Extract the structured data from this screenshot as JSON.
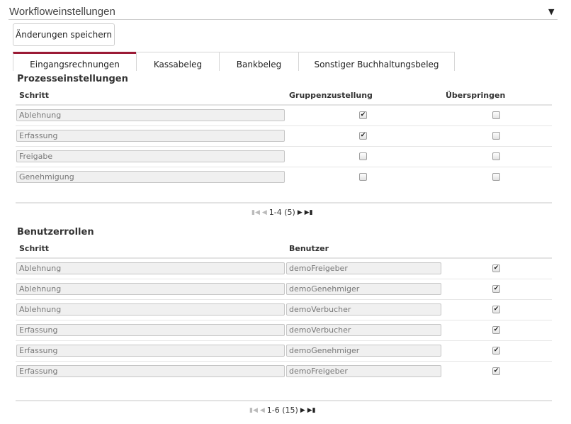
{
  "header": {
    "title": "Workfloweinstellungen",
    "collapse_icon": "▼"
  },
  "toolbar": {
    "save_label": "Änderungen speichern"
  },
  "tabs": [
    {
      "label": "Eingangsrechnungen",
      "active": true
    },
    {
      "label": "Kassabeleg",
      "active": false
    },
    {
      "label": "Bankbeleg",
      "active": false
    },
    {
      "label": "Sonstiger Buchhaltungsbeleg",
      "active": false
    }
  ],
  "process": {
    "title": "Prozesseinstellungen",
    "columns": [
      "Schritt",
      "Gruppenzustellung",
      "Überspringen"
    ],
    "rows": [
      {
        "step": "Ablehnung",
        "group": true,
        "skip": false
      },
      {
        "step": "Erfassung",
        "group": true,
        "skip": false
      },
      {
        "step": "Freigabe",
        "group": false,
        "skip": false
      },
      {
        "step": "Genehmigung",
        "group": false,
        "skip": false
      }
    ],
    "pager": "1-4 (5)"
  },
  "roles": {
    "title": "Benutzerrollen",
    "columns": [
      "Schritt",
      "Benutzer"
    ],
    "rows": [
      {
        "step": "Ablehnung",
        "user": "demoFreigeber",
        "checked": true
      },
      {
        "step": "Ablehnung",
        "user": "demoGenehmiger",
        "checked": true
      },
      {
        "step": "Ablehnung",
        "user": "demoVerbucher",
        "checked": true
      },
      {
        "step": "Erfassung",
        "user": "demoVerbucher",
        "checked": true
      },
      {
        "step": "Erfassung",
        "user": "demoGenehmiger",
        "checked": true
      },
      {
        "step": "Erfassung",
        "user": "demoFreigeber",
        "checked": true
      }
    ],
    "pager": "1-6 (15)"
  },
  "colors": {
    "accent": "#9b1a35"
  }
}
